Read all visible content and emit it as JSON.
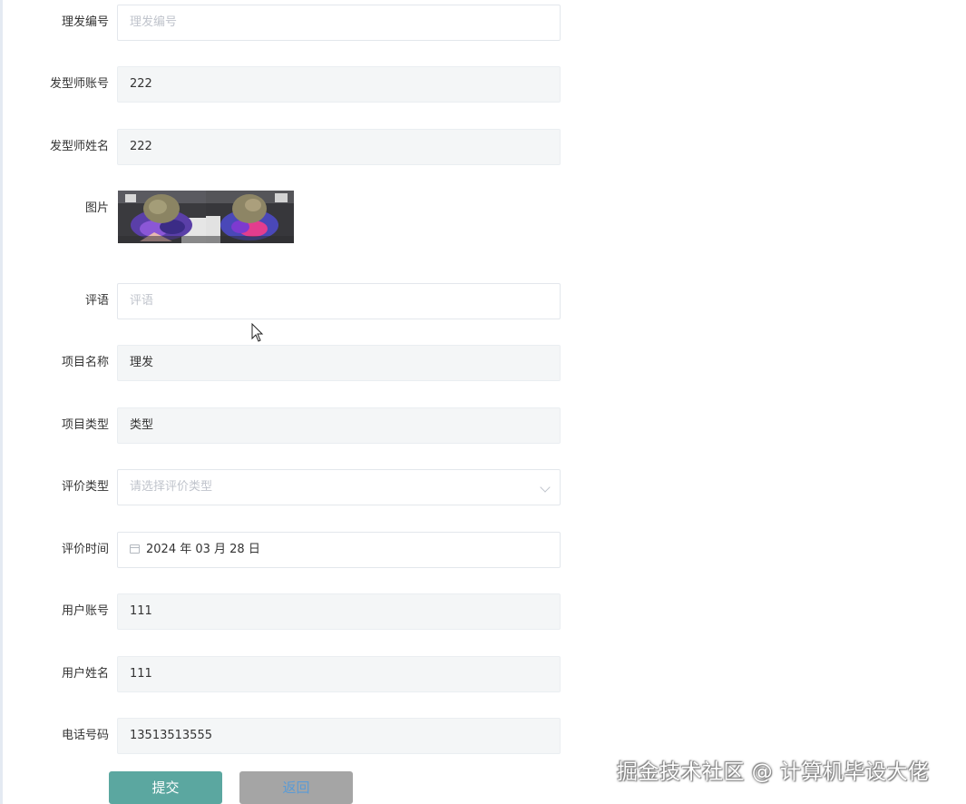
{
  "form": {
    "fields": [
      {
        "label": "理发编号",
        "value": "",
        "placeholder": "理发编号"
      },
      {
        "label": "发型师账号",
        "value": "222",
        "placeholder": ""
      },
      {
        "label": "发型师姓名",
        "value": "222",
        "placeholder": ""
      },
      {
        "label": "图片"
      },
      {
        "label": "评语",
        "value": "",
        "placeholder": "评语"
      },
      {
        "label": "项目名称",
        "value": "理发",
        "placeholder": ""
      },
      {
        "label": "项目类型",
        "value": "类型",
        "placeholder": ""
      },
      {
        "label": "评价类型",
        "value": "",
        "placeholder": "请选择评价类型"
      },
      {
        "label": "评价时间",
        "value": "2024 年 03 月 28 日",
        "placeholder": ""
      },
      {
        "label": "用户账号",
        "value": "111",
        "placeholder": ""
      },
      {
        "label": "用户姓名",
        "value": "111",
        "placeholder": ""
      },
      {
        "label": "电话号码",
        "value": "13513513555",
        "placeholder": ""
      }
    ],
    "photos": [
      "hair-photo-1",
      "hair-photo-2"
    ]
  },
  "buttons": {
    "submit": "提交",
    "back": "返回"
  },
  "watermark": "掘金技术社区 @ 计算机毕设大佬",
  "icons": {
    "date": "calendar-icon",
    "select": "chevron-down-icon"
  },
  "colors": {
    "submit": "#5ba7a0",
    "back": "#a5a5a5",
    "readonly_bg": "#f4f6f7"
  }
}
